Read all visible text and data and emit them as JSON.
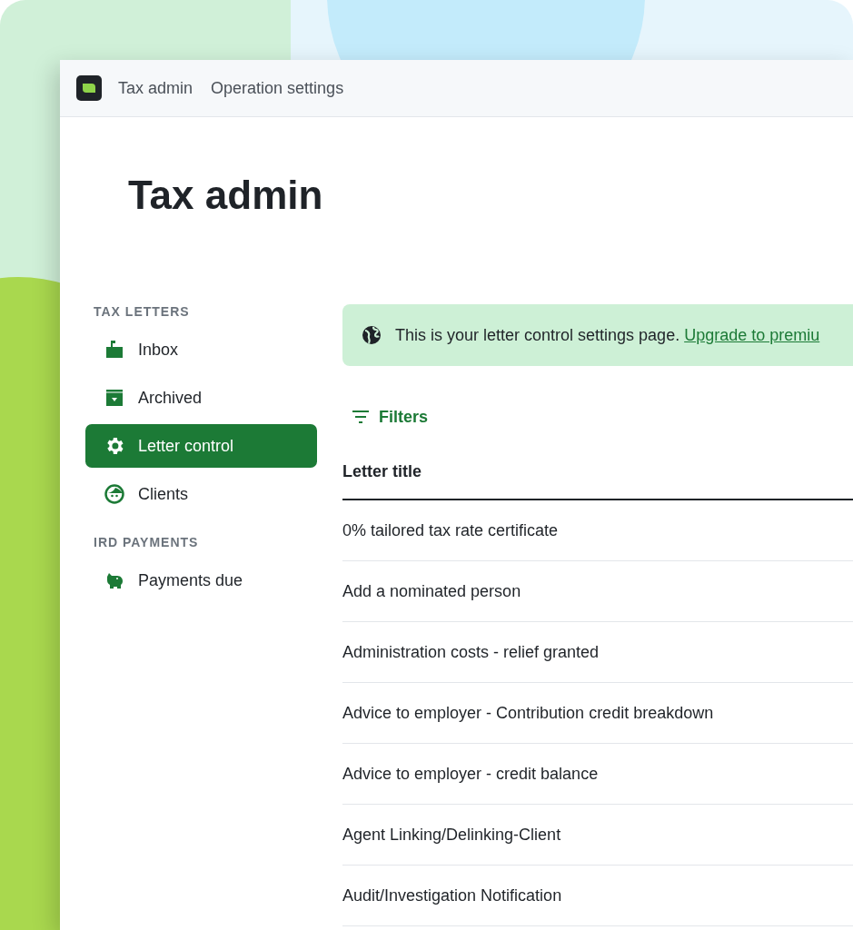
{
  "topbar": {
    "crumbs": [
      "Tax admin",
      "Operation settings"
    ]
  },
  "page_title": "Tax admin",
  "sidebar": {
    "sections": [
      {
        "heading": "TAX LETTERS",
        "items": [
          {
            "label": "Inbox",
            "selected": false
          },
          {
            "label": "Archived",
            "selected": false
          },
          {
            "label": "Letter control",
            "selected": true
          },
          {
            "label": "Clients",
            "selected": false
          }
        ]
      },
      {
        "heading": "IRD PAYMENTS",
        "items": [
          {
            "label": "Payments due",
            "selected": false
          }
        ]
      }
    ]
  },
  "banner": {
    "text": "This is your letter control settings page.",
    "link": "Upgrade to premiu"
  },
  "filters_button": "Filters",
  "table": {
    "columns": [
      "Letter title"
    ],
    "rows": [
      "0% tailored tax rate certificate",
      "Add a nominated person",
      "Administration costs - relief granted",
      "Advice to employer - Contribution credit breakdown",
      "Advice to employer - credit balance",
      "Agent Linking/Delinking-Client",
      "Audit/Investigation Notification"
    ]
  }
}
